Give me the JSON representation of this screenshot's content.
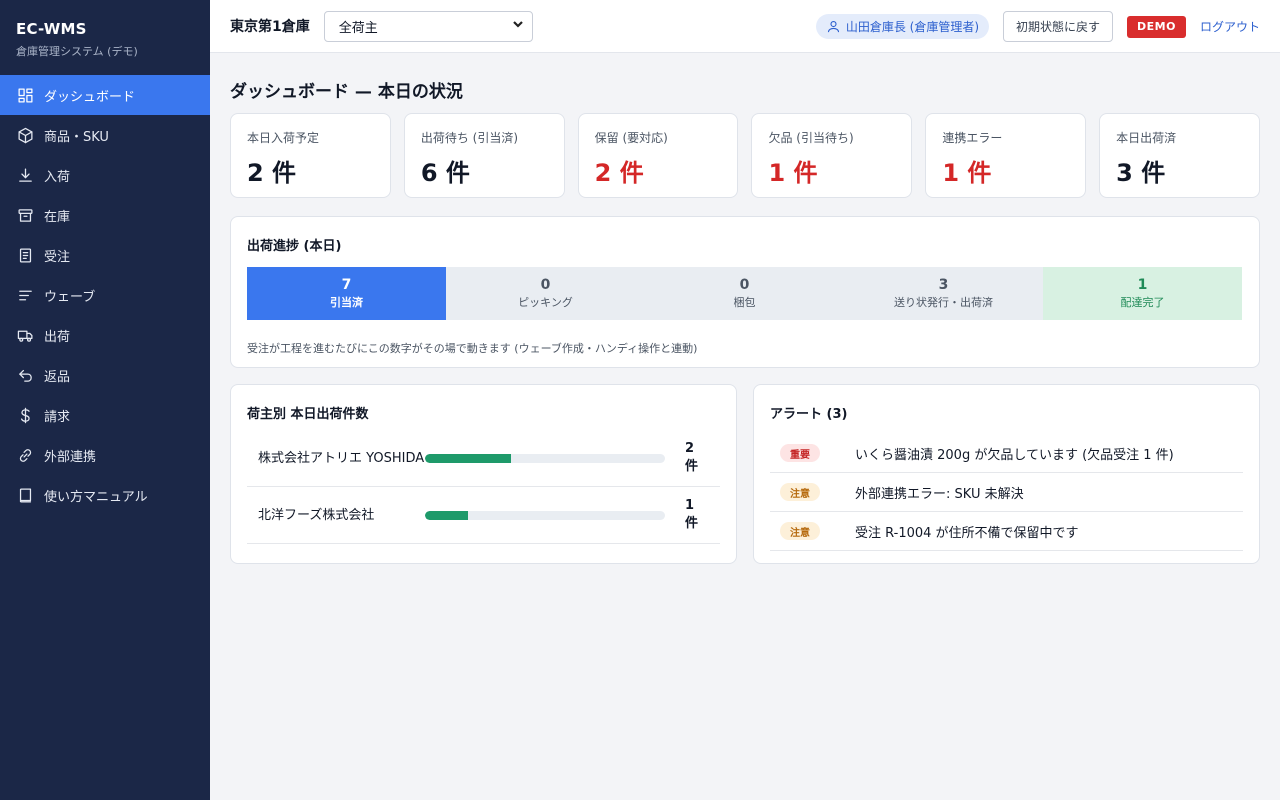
{
  "brand": {
    "title": "EC-WMS",
    "subtitle": "倉庫管理システム (デモ)"
  },
  "sidebar": {
    "items": [
      {
        "label": "ダッシュボード",
        "icon": "dashboard-icon",
        "active": true
      },
      {
        "label": "商品・SKU",
        "icon": "package-icon",
        "active": false
      },
      {
        "label": "入荷",
        "icon": "download-icon",
        "active": false
      },
      {
        "label": "在庫",
        "icon": "archive-icon",
        "active": false
      },
      {
        "label": "受注",
        "icon": "document-icon",
        "active": false
      },
      {
        "label": "ウェーブ",
        "icon": "lines-icon",
        "active": false
      },
      {
        "label": "出荷",
        "icon": "truck-icon",
        "active": false
      },
      {
        "label": "返品",
        "icon": "undo-icon",
        "active": false
      },
      {
        "label": "請求",
        "icon": "dollar-icon",
        "active": false
      },
      {
        "label": "外部連携",
        "icon": "link-icon",
        "active": false
      },
      {
        "label": "使い方マニュアル",
        "icon": "book-icon",
        "active": false
      }
    ]
  },
  "header": {
    "warehouse": "東京第1倉庫",
    "shipper_select": "全荷主",
    "user": "山田倉庫長 (倉庫管理者)",
    "reset_label": "初期状態に戻す",
    "demo_label": "DEMO",
    "logout_label": "ログアウト"
  },
  "main": {
    "title": "ダッシュボード — 本日の状況",
    "stats": [
      {
        "label": "本日入荷予定",
        "value": "2 件",
        "alert": false
      },
      {
        "label": "出荷待ち (引当済)",
        "value": "6 件",
        "alert": false
      },
      {
        "label": "保留 (要対応)",
        "value": "2 件",
        "alert": true
      },
      {
        "label": "欠品 (引当待ち)",
        "value": "1 件",
        "alert": true
      },
      {
        "label": "連携エラー",
        "value": "1 件",
        "alert": true
      },
      {
        "label": "本日出荷済",
        "value": "3 件",
        "alert": false
      }
    ],
    "progress": {
      "title": "出荷進捗 (本日)",
      "stages": [
        {
          "count": "7",
          "label": "引当済",
          "state": "active"
        },
        {
          "count": "0",
          "label": "ピッキング",
          "state": ""
        },
        {
          "count": "0",
          "label": "梱包",
          "state": ""
        },
        {
          "count": "3",
          "label": "送り状発行・出荷済",
          "state": ""
        },
        {
          "count": "1",
          "label": "配達完了",
          "state": "done"
        }
      ],
      "note": "受注が工程を進むたびにこの数字がその場で動きます (ウェーブ作成・ハンディ操作と連動)"
    },
    "shippers": {
      "title": "荷主別 本日出荷件数",
      "rows": [
        {
          "name": "株式会社アトリエ YOSHIDA",
          "count": "2 件",
          "fill": 0.36
        },
        {
          "name": "北洋フーズ株式会社",
          "count": "1 件",
          "fill": 0.18
        }
      ]
    },
    "alerts": {
      "title": "アラート (3)",
      "items": [
        {
          "level": "重要",
          "kind": "critical",
          "text": "いくら醤油漬 200g が欠品しています (欠品受注 1 件)"
        },
        {
          "level": "注意",
          "kind": "warn",
          "text": "外部連携エラー: SKU 未解決"
        },
        {
          "level": "注意",
          "kind": "warn",
          "text": "受注 R-1004 が住所不備で保留中です"
        }
      ]
    }
  }
}
